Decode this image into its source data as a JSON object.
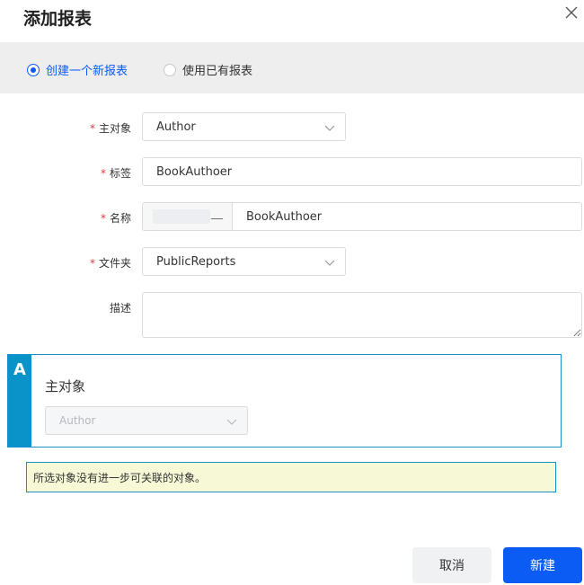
{
  "dialog": {
    "title": "添加报表"
  },
  "mode": {
    "options": [
      {
        "label": "创建一个新报表",
        "selected": true
      },
      {
        "label": "使用已有报表",
        "selected": false
      }
    ]
  },
  "form": {
    "primary_object": {
      "label": "主对象",
      "required": true,
      "value": "Author"
    },
    "tag": {
      "label": "标签",
      "required": true,
      "value": "BookAuthoer"
    },
    "name": {
      "label": "名称",
      "required": true,
      "prefix_suffix": "__",
      "value": "BookAuthoer"
    },
    "folder": {
      "label": "文件夹",
      "required": true,
      "value": "PublicReports"
    },
    "description": {
      "label": "描述",
      "required": false,
      "value": ""
    }
  },
  "panel": {
    "tab_letter": "A",
    "title": "主对象",
    "select_value": "Author"
  },
  "note": {
    "text": "所选对象没有进一步可关联的对象。"
  },
  "buttons": {
    "cancel_label": "取消",
    "create_label": "新建"
  },
  "colors": {
    "accent": "#0a5cf5",
    "panel_border": "#1a8fc8",
    "panel_tab": "#0a93c9",
    "required": "#e03a3a",
    "note_bg": "#f7f9d6"
  },
  "icons": {
    "close": "close-icon",
    "chevron": "chevron-down-icon"
  }
}
